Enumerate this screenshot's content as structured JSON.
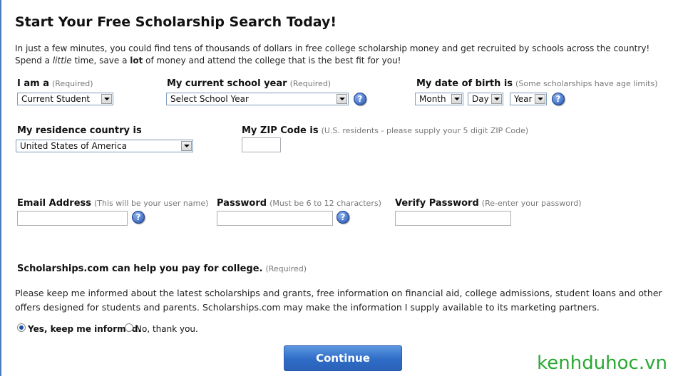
{
  "title": "Start Your Free Scholarship Search Today!",
  "intro": {
    "p1": "In just a few minutes, you could find tens of thousands of dollars in free college scholarship money and get recruited by schools across the country!",
    "p2a": "Spend a ",
    "p2_italic": "little",
    "p2b": " time, save a ",
    "p2_bold": "lot",
    "p2c": " of money and attend the college that is the best fit for you!"
  },
  "fields": {
    "iam": {
      "label": "I am a",
      "hint": "(Required)",
      "value": "Current Student"
    },
    "school_year": {
      "label": "My current school year",
      "hint": "(Required)",
      "value": "Select School Year"
    },
    "dob": {
      "label": "My date of birth is",
      "hint": "(Some scholarships have age limits)",
      "month": "Month",
      "day": "Day",
      "year": "Year"
    },
    "country": {
      "label": "My residence country is",
      "value": "United States of America"
    },
    "zip": {
      "label": "My ZIP Code is",
      "hint": "(U.S. residents - please supply your 5 digit ZIP Code)",
      "value": ""
    },
    "email": {
      "label": "Email Address",
      "hint": "(This will be your user name)",
      "value": ""
    },
    "password": {
      "label": "Password",
      "hint": "(Must be 6 to 12 characters)",
      "value": ""
    },
    "verify": {
      "label": "Verify Password",
      "hint": "(Re-enter your password)",
      "value": ""
    }
  },
  "optin": {
    "heading": "Scholarships.com can help you pay for college.",
    "hint": "(Required)",
    "text": "Please keep me informed about the latest scholarships and grants, free information on financial aid, college admissions, student loans and other offers designed for students and parents. Scholarships.com may make the information I supply available to its marketing partners.",
    "yes_label": "Yes, keep me informed.",
    "no_label": "No, thank you.",
    "selected": "yes"
  },
  "continue_label": "Continue",
  "watermark": "kenhduhoc.vn",
  "colors": {
    "accent": "#2f6cc7",
    "help_icon": "#2356b8",
    "hint_text": "#777777",
    "watermark": "#2aa832"
  }
}
